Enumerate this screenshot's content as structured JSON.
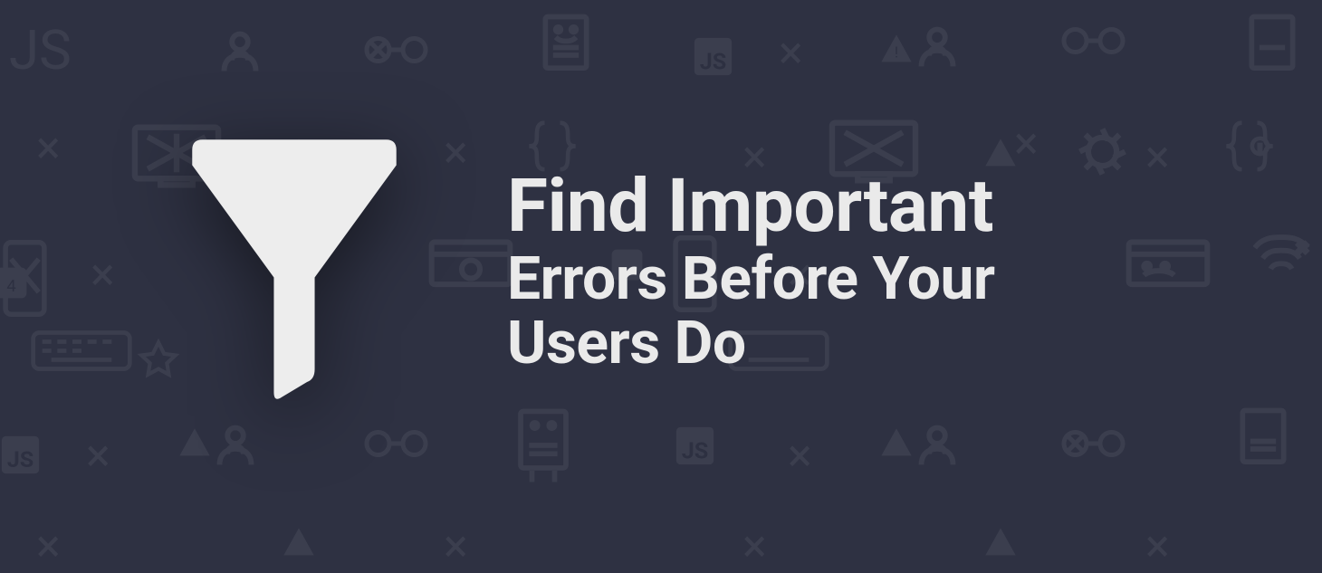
{
  "headline": {
    "line1": "Find Important",
    "line2": "Errors Before Your",
    "line3": "Users Do"
  },
  "icon_name": "funnel",
  "colors": {
    "background": "#2e3142",
    "text": "#eaeaea"
  }
}
